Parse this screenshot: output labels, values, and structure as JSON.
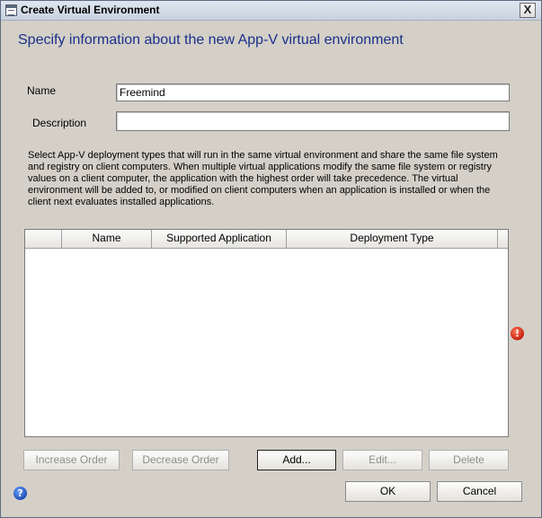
{
  "window": {
    "title": "Create Virtual Environment",
    "close_glyph": "X"
  },
  "header": "Specify information about the new App-V virtual environment",
  "form": {
    "name_label": "Name",
    "name_value": "Freemind",
    "description_label": "Description",
    "description_value": ""
  },
  "instructions": "Select App-V deployment types that will run in the same virtual environment and share the same file system and registry on client computers. When multiple virtual applications modify the same file system or registry values on a client computer, the application with the highest order will take precedence. The virtual environment will be added to, or modified on client computers when an application is installed or when the client next evaluates installed applications.",
  "list": {
    "columns": [
      "",
      "Name",
      "Supported Application",
      "Deployment Type"
    ],
    "rows": []
  },
  "icons": {
    "warning": "!",
    "help": "?"
  },
  "buttons": {
    "increase_order": "Increase Order",
    "decrease_order": "Decrease Order",
    "add": "Add...",
    "edit": "Edit...",
    "delete": "Delete",
    "ok": "OK",
    "cancel": "Cancel"
  },
  "colors": {
    "header_text": "#1a2f8a",
    "dialog_bg": "#d4d0c8",
    "warning": "#c8200e",
    "help": "#1f4fb5"
  }
}
